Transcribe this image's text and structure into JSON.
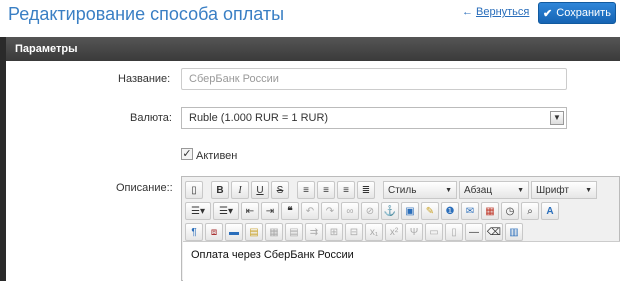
{
  "header": {
    "title": "Редактирование способа оплаты",
    "back_arrow": "←",
    "back_label": "Вернуться",
    "save_label": "Сохранить",
    "accent": "#1e73c8"
  },
  "panel": {
    "title": "Параметры"
  },
  "form": {
    "name_label": "Название:",
    "name_placeholder": "СберБанк России",
    "currency_label": "Валюта:",
    "currency_value": "Ruble (1.000 RUR = 1 RUR)",
    "active_label": "Активен",
    "active_checked": true,
    "description_label": "Описание::"
  },
  "editor": {
    "style_combo": "Стиль",
    "format_combo": "Абзац",
    "font_combo": "Шрифт",
    "content": "Оплата через СберБанк России",
    "toolbar_row1": [
      "document-icon",
      "bold-icon",
      "italic-icon",
      "underline-icon",
      "strikethrough-icon",
      "align-left-icon",
      "align-center-icon",
      "align-right-icon",
      "align-justify-icon"
    ],
    "toolbar_row2": [
      "bullet-list-icon",
      "numbered-list-icon",
      "outdent-icon",
      "indent-icon",
      "quote-icon",
      "undo-icon",
      "redo-icon",
      "link-icon",
      "unlink-icon",
      "anchor-icon",
      "image-icon",
      "cleanup-icon",
      "help-icon",
      "email-icon",
      "date-icon",
      "time-icon",
      "preview-icon",
      "font-color-icon"
    ],
    "toolbar_row3": [
      "paragraph-icon",
      "code-icon",
      "hr-icon",
      "paste-icon",
      "table-icon",
      "table-row-icon",
      "table-col-icon",
      "merge-cells-icon",
      "split-cells-icon",
      "subscript-icon",
      "superscript-icon",
      "special-char-icon",
      "layer-icon",
      "absolute-icon",
      "line-icon",
      "eraser-icon",
      "visual-aid-icon"
    ]
  }
}
